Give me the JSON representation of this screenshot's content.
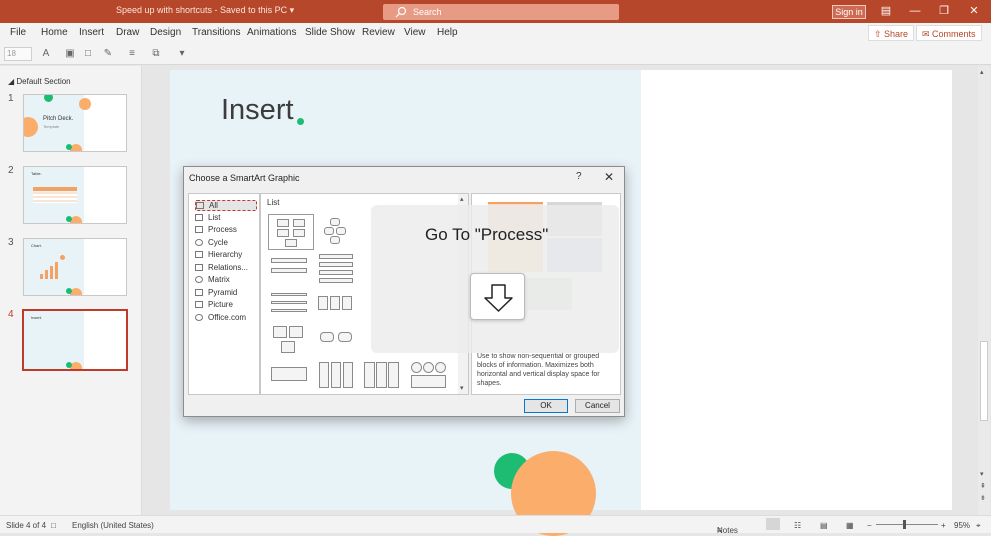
{
  "titlebar": {
    "title": "Speed up with shortcuts  -  Saved to this PC  ▾",
    "search_placeholder": "Search",
    "signin_label": "Sign in",
    "minimize": "—",
    "restore": "❐",
    "close": "✕",
    "ribbon_display": "▤"
  },
  "menu": {
    "items": [
      "File",
      "Home",
      "Insert",
      "Draw",
      "Design",
      "Transitions",
      "Animations",
      "Slide Show",
      "Review",
      "View",
      "Help"
    ],
    "share_label": "Share",
    "comments_label": "Comments"
  },
  "toolbar": {
    "font_size": "18"
  },
  "slidepanel": {
    "section_label": "Default Section",
    "thumbs": [
      {
        "num": "1",
        "text": "Pitch Deck.",
        "sub": "Template"
      },
      {
        "num": "2",
        "text": "Table."
      },
      {
        "num": "3",
        "text": "Chart."
      },
      {
        "num": "4",
        "text": "Insert."
      }
    ]
  },
  "slide": {
    "title": "Insert"
  },
  "dialog": {
    "title": "Choose a SmartArt Graphic",
    "help": "?",
    "close": "✕",
    "categories": [
      "All",
      "List",
      "Process",
      "Cycle",
      "Hierarchy",
      "Relations...",
      "Matrix",
      "Pyramid",
      "Picture",
      "Office.com"
    ],
    "selected_category": "All",
    "gallery_header": "List",
    "preview_desc": "Use to show non-sequential or grouped blocks of information. Maximizes both horizontal and vertical display space for shapes.",
    "ok_label": "OK",
    "cancel_label": "Cancel"
  },
  "overlay": {
    "text": "Go To \"Process\""
  },
  "statusbar": {
    "slide_info": "Slide 4 of 4",
    "language": "English (United States)",
    "notes": "Notes",
    "zoom": "95%"
  },
  "colors": {
    "accent": "#b7472a",
    "green": "#1dbc73",
    "orange": "#fbad6c"
  }
}
